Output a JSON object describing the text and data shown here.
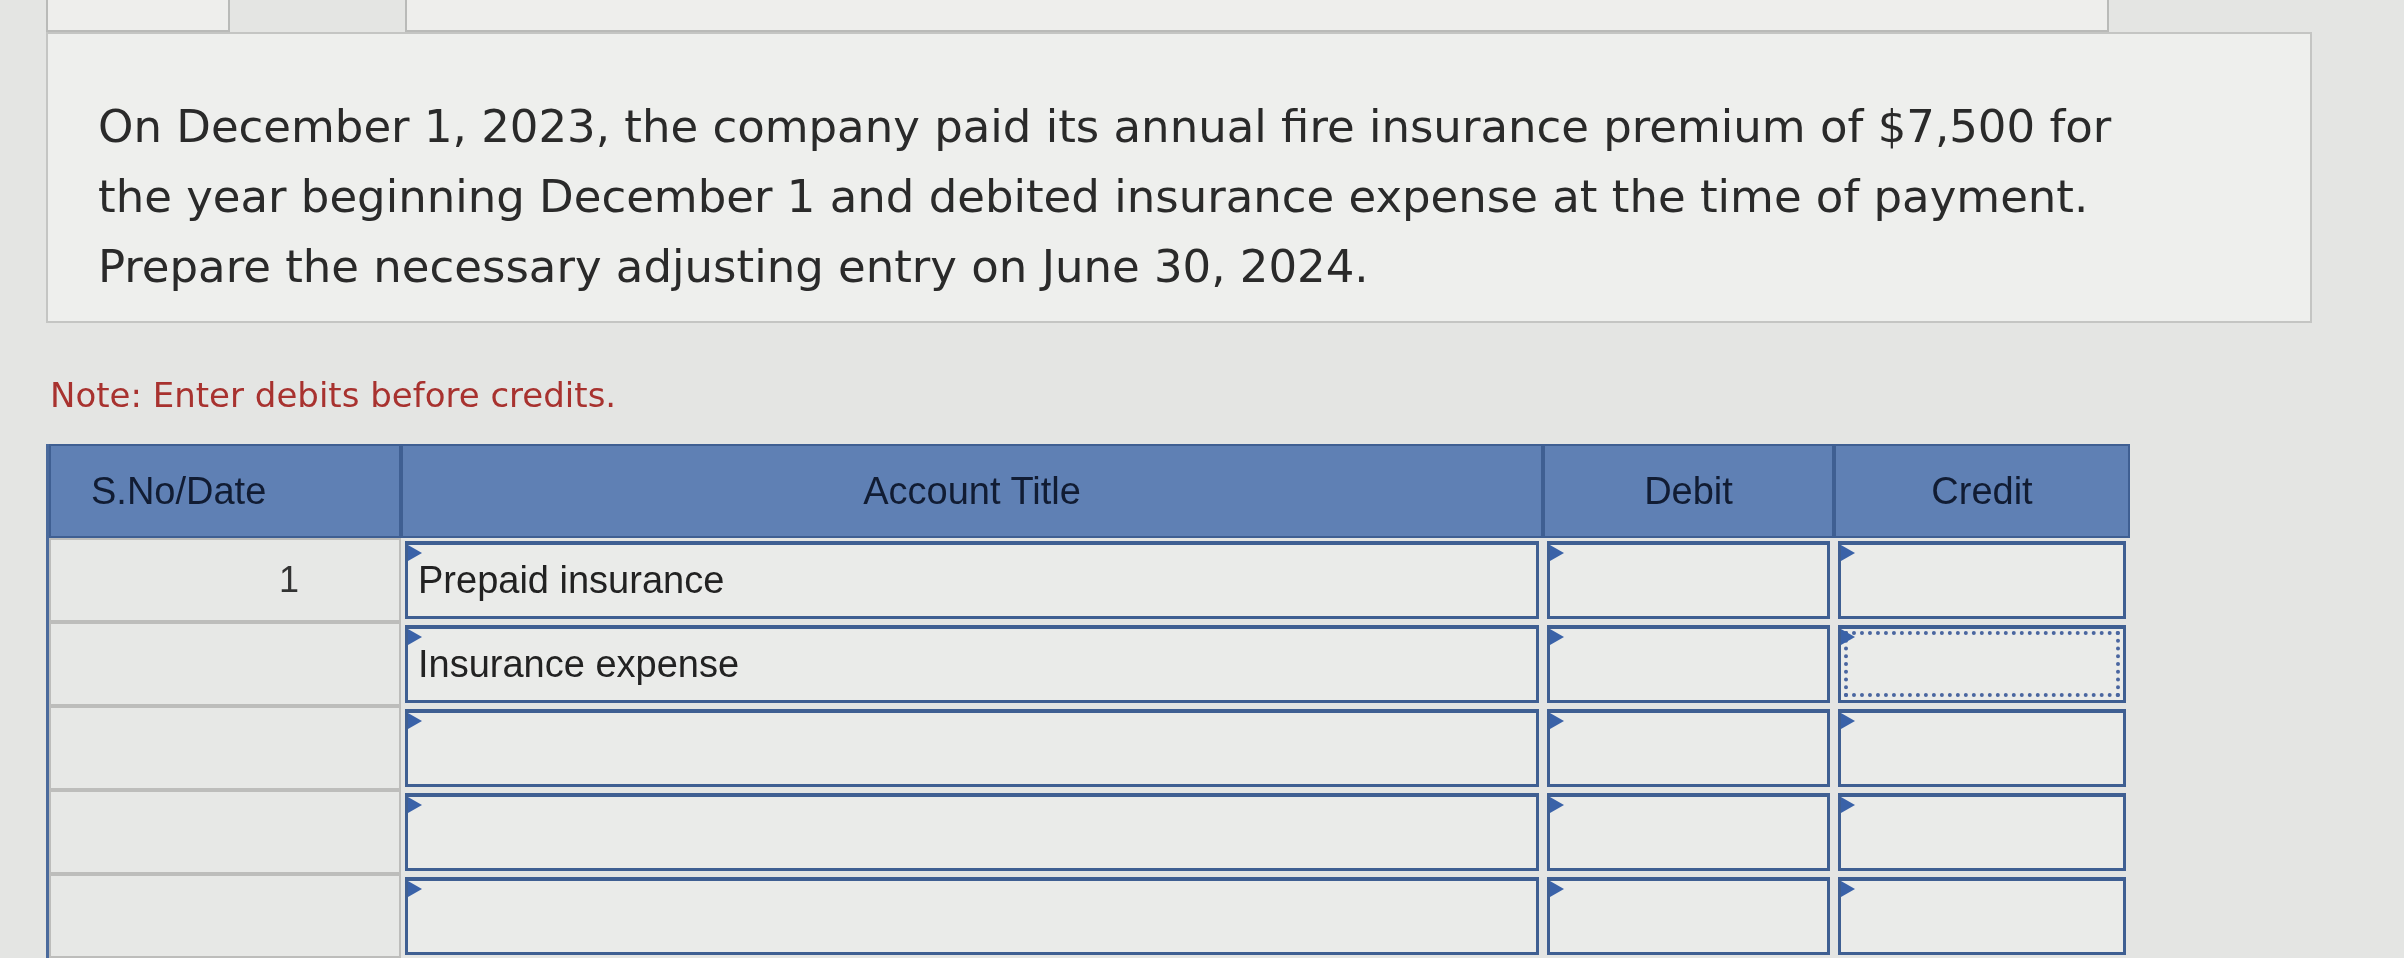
{
  "question": "On December 1, 2023, the company paid its annual fire insurance premium of $7,500 for the year beginning December 1 and debited insurance expense at the time of payment. Prepare the necessary adjusting entry on June 30, 2024.",
  "note": "Note: Enter debits before credits.",
  "table": {
    "columns": [
      "S.No/Date",
      "Account Title",
      "Debit",
      "Credit"
    ],
    "rows": [
      {
        "date": "1",
        "account": "Prepaid insurance",
        "credit_focused": false
      },
      {
        "account": "Insurance expense",
        "credit_focused": true
      },
      {
        "credit_focused": false
      },
      {
        "credit_focused": false
      },
      {
        "credit_focused": false
      }
    ]
  }
}
